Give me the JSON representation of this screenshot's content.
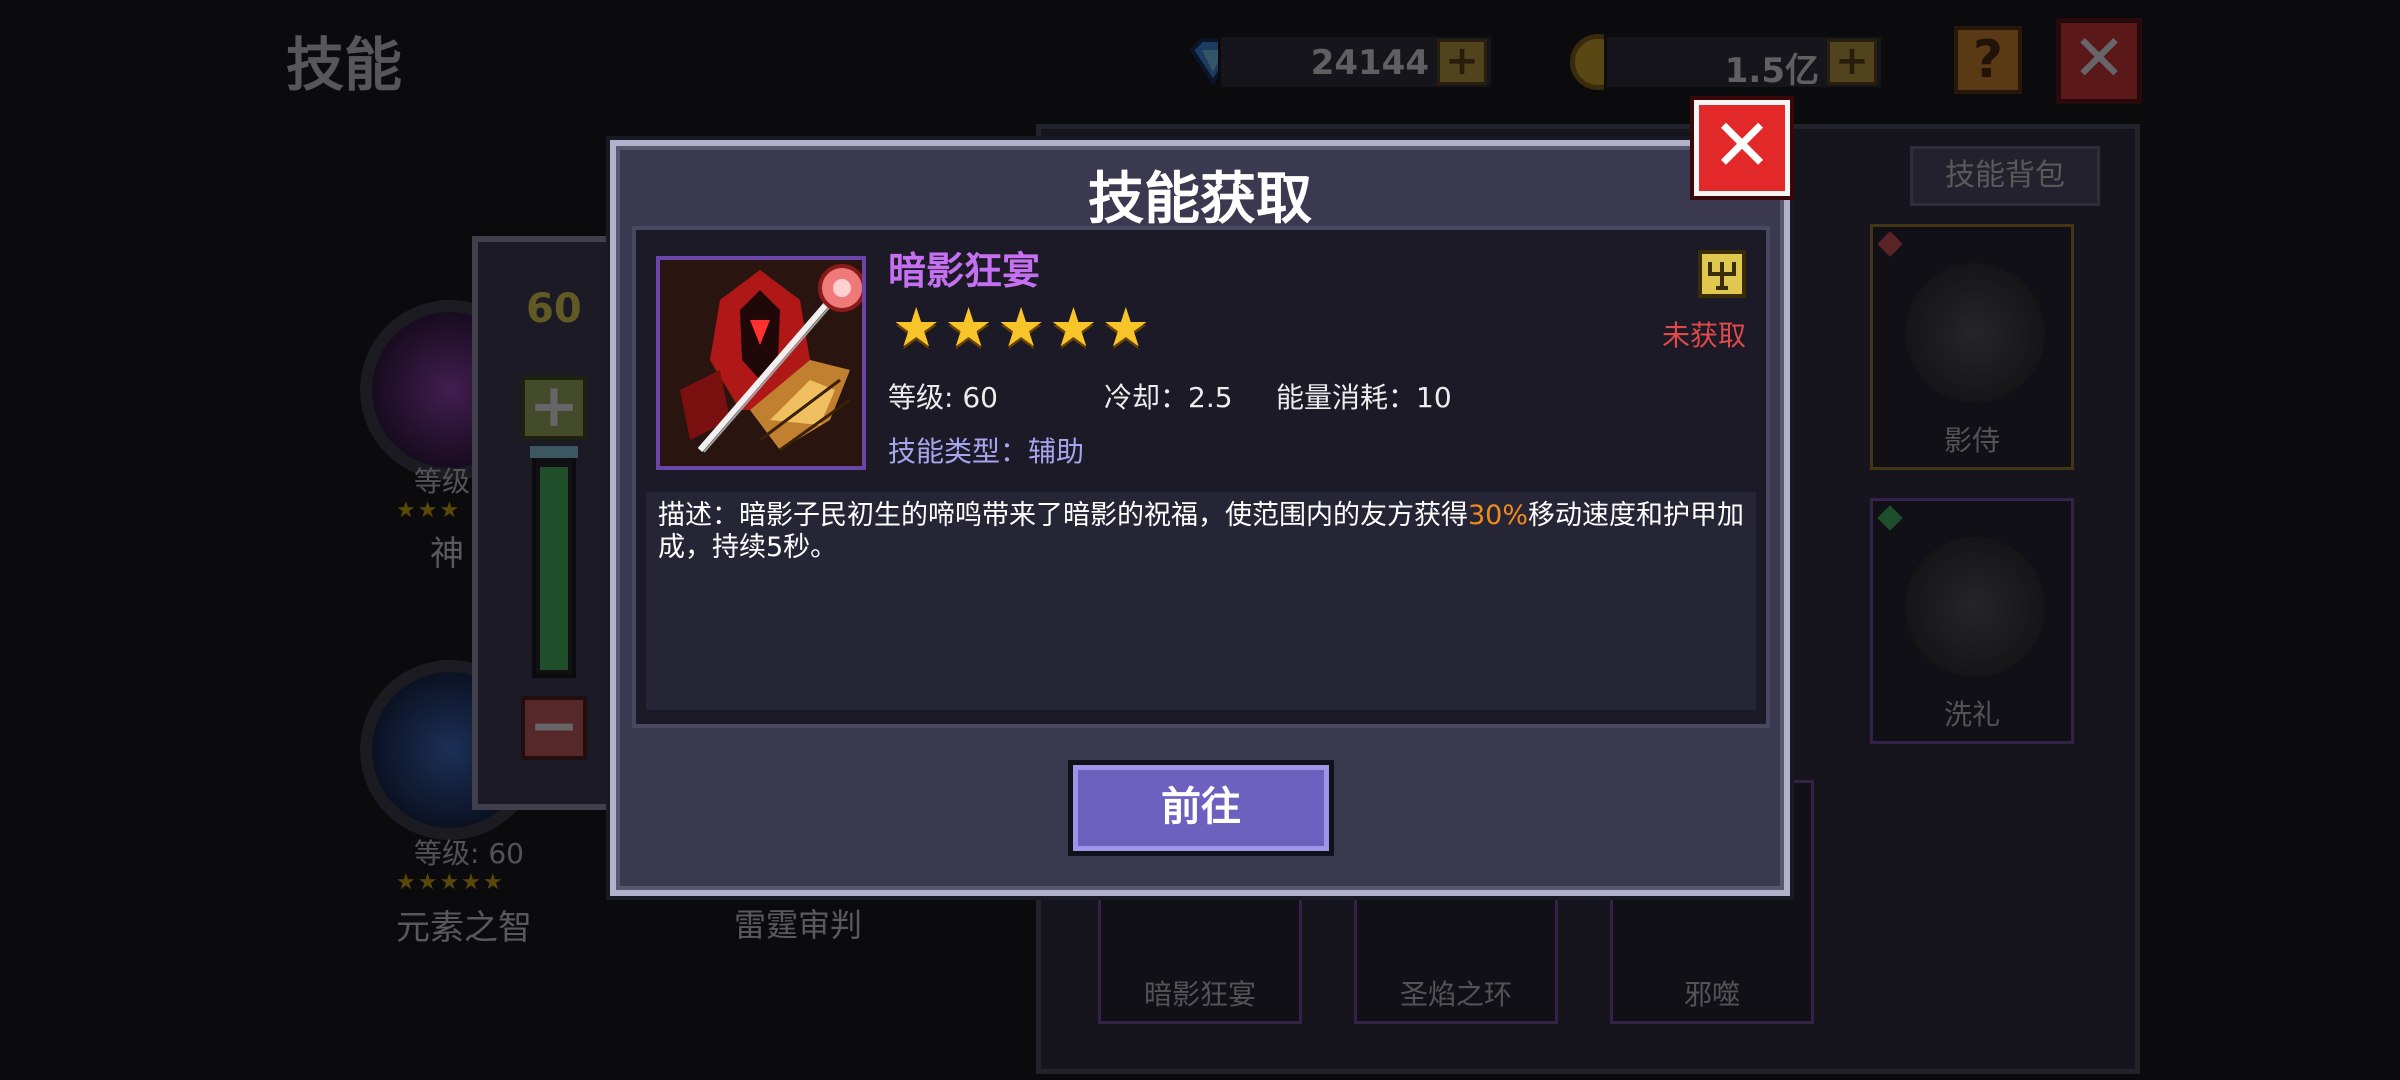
{
  "page": {
    "title": "技能",
    "gems": "24144",
    "gold": "1.5亿",
    "plus_symbol": "+",
    "help_symbol": "?",
    "close_symbol": "✕",
    "bag_button": "技能背包"
  },
  "left_skills": [
    {
      "level_text": "等级",
      "name": "神",
      "stars": "★★★"
    },
    {
      "level_text": "等级: 60",
      "name": "元素之智",
      "stars": "★★★★★"
    },
    {
      "name": "雷霆审判"
    }
  ],
  "grid_skills": [
    {
      "name": "影侍",
      "border": "#a77d28",
      "gem": "#e05050"
    },
    {
      "name": "洗礼",
      "border": "#7a4ab0",
      "gem": "#40c060"
    },
    {
      "name": "暗影狂宴",
      "border": "#7a4ab0"
    },
    {
      "name": "圣焰之环",
      "border": "#7a4ab0"
    },
    {
      "name": "邪噬",
      "border": "#7a4ab0"
    }
  ],
  "level_slider": {
    "value": "60",
    "fill_fraction": 0.95,
    "plus": "+",
    "minus": "−"
  },
  "modal": {
    "title": "技能获取",
    "close": "✕",
    "skill_name": "暗影狂宴",
    "stars": "★★★★★",
    "star_count": 5,
    "status": "未获取",
    "level": "等级: 60",
    "cooldown": "冷却：2.5",
    "energy": "能量消耗：10",
    "type": "技能类型：辅助",
    "desc_before": "描述：暗影子民初生的啼鸣带来了暗影的祝福，使范围内的友方获得",
    "desc_highlight": "30%",
    "desc_after": "移动速度和护甲加成，持续5秒。",
    "go_button": "前往"
  },
  "colors": {
    "skill_name": "#c470f0",
    "status": "#e04a4a",
    "highlight": "#f08c1c",
    "type": "#a8a4ee",
    "button": "#6d61c0",
    "star": "#f7c52a"
  }
}
